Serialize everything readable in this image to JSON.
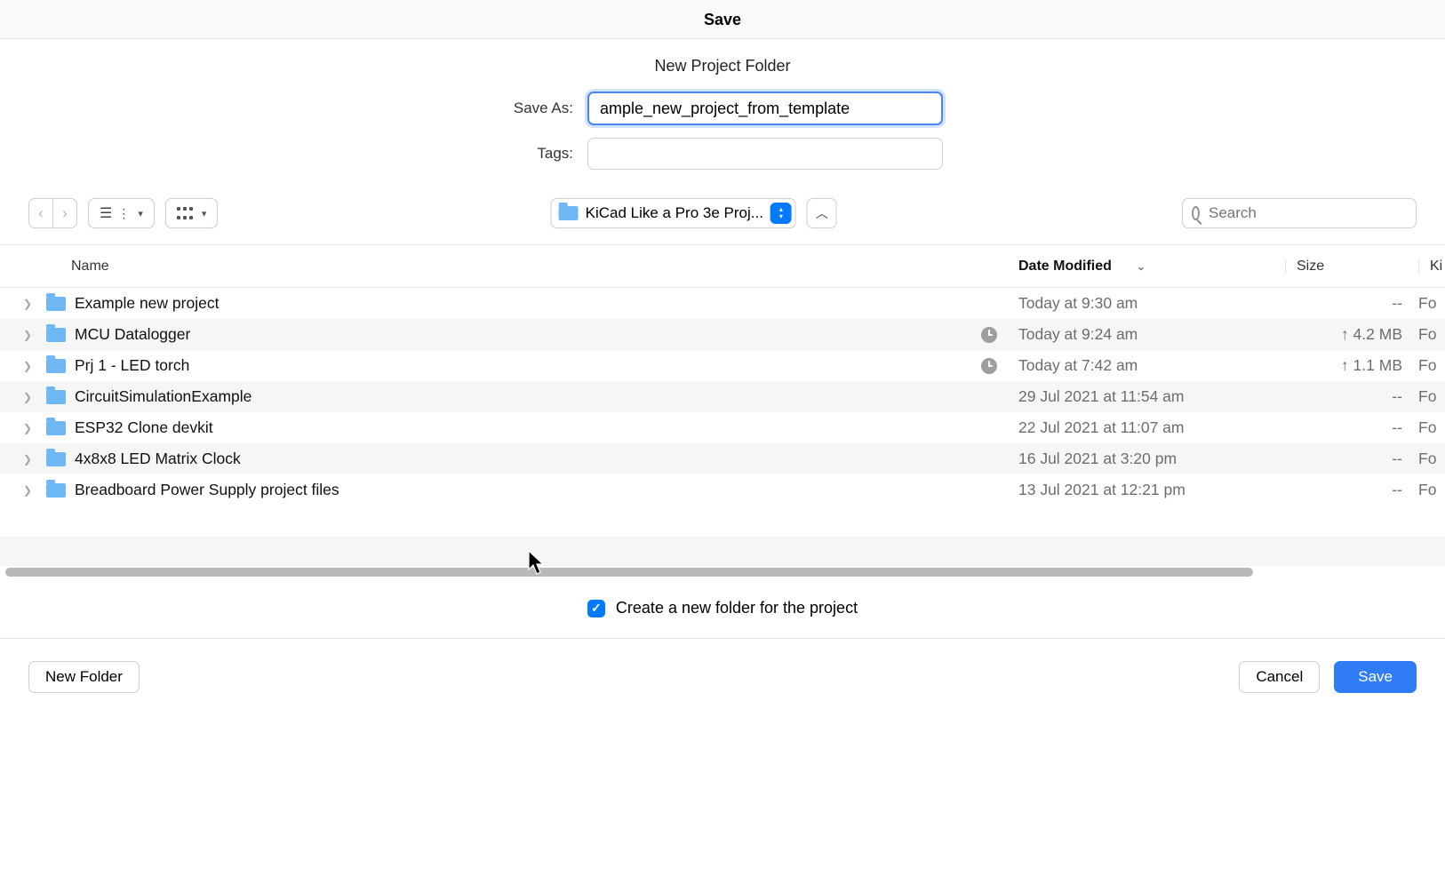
{
  "window": {
    "title": "Save"
  },
  "form": {
    "subtitle": "New Project Folder",
    "save_as_label": "Save As:",
    "save_as_value": "ample_new_project_from_template",
    "tags_label": "Tags:",
    "tags_value": ""
  },
  "toolbar": {
    "location_name": "KiCad Like a Pro 3e Proj...",
    "search_placeholder": "Search"
  },
  "columns": {
    "name": "Name",
    "date": "Date Modified",
    "size": "Size",
    "kind": "Ki"
  },
  "rows": [
    {
      "name": "Example new project",
      "date": "Today at 9:30 am",
      "size": "--",
      "kind": "Fo",
      "sync": false,
      "up": false
    },
    {
      "name": "MCU Datalogger",
      "date": "Today at 9:24 am",
      "size": "4.2 MB",
      "kind": "Fo",
      "sync": true,
      "up": true
    },
    {
      "name": "Prj 1 - LED torch",
      "date": "Today at 7:42 am",
      "size": "1.1 MB",
      "kind": "Fo",
      "sync": true,
      "up": true
    },
    {
      "name": "CircuitSimulationExample",
      "date": "29 Jul 2021 at 11:54 am",
      "size": "--",
      "kind": "Fo",
      "sync": false,
      "up": false
    },
    {
      "name": "ESP32 Clone devkit",
      "date": "22 Jul 2021 at 11:07 am",
      "size": "--",
      "kind": "Fo",
      "sync": false,
      "up": false
    },
    {
      "name": "4x8x8 LED Matrix Clock",
      "date": "16 Jul 2021 at 3:20 pm",
      "size": "--",
      "kind": "Fo",
      "sync": false,
      "up": false
    },
    {
      "name": "Breadboard Power Supply project files",
      "date": "13 Jul 2021 at 12:21 pm",
      "size": "--",
      "kind": "Fo",
      "sync": false,
      "up": false
    }
  ],
  "options": {
    "create_folder_label": "Create a new folder for the project",
    "create_folder_checked": true
  },
  "footer": {
    "new_folder": "New Folder",
    "cancel": "Cancel",
    "save": "Save"
  },
  "colors": {
    "accent": "#007aff",
    "primary_button": "#2f7cf6",
    "folder": "#6fb8f5"
  }
}
